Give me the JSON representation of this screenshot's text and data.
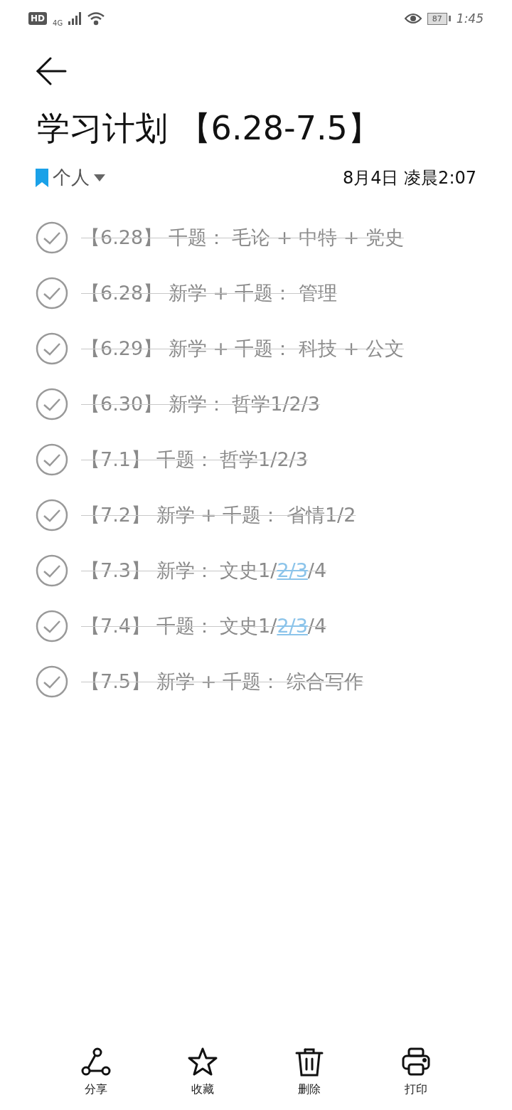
{
  "status_bar": {
    "hd": "HD",
    "network": "4G",
    "battery": "87",
    "time": "1:45"
  },
  "note": {
    "title": "学习计划 【6.28-7.5】",
    "category": "个人",
    "date": "8月4日 凌晨2:07"
  },
  "items": [
    {
      "done": true,
      "segments": [
        {
          "text": "【6.28】 千题： 毛论 + 中特 + 党史"
        }
      ]
    },
    {
      "done": true,
      "segments": [
        {
          "text": "【6.28】 新学 + 千题： 管理"
        }
      ]
    },
    {
      "done": true,
      "segments": [
        {
          "text": "【6.29】 新学 + 千题： 科技 + 公文"
        }
      ]
    },
    {
      "done": true,
      "segments": [
        {
          "text": "【6.30】 新学： 哲学1/2/3"
        }
      ]
    },
    {
      "done": true,
      "segments": [
        {
          "text": "【7.1】 千题： 哲学1/2/3"
        }
      ]
    },
    {
      "done": true,
      "segments": [
        {
          "text": "【7.2】 新学 + 千题： 省情1/2"
        }
      ]
    },
    {
      "done": true,
      "segments": [
        {
          "text": "【7.3】 新学： 文史1/"
        },
        {
          "text": "2/3",
          "kind": "link"
        },
        {
          "text": "/4"
        }
      ]
    },
    {
      "done": true,
      "segments": [
        {
          "text": "【7.4】 千题： 文史1/"
        },
        {
          "text": "2/3",
          "kind": "link"
        },
        {
          "text": "/4"
        }
      ]
    },
    {
      "done": true,
      "segments": [
        {
          "text": "【7.5】 新学 + 千题： 综合写作"
        }
      ]
    }
  ],
  "toolbar": [
    {
      "kind": "share",
      "label": "分享"
    },
    {
      "kind": "favorite",
      "label": "收藏"
    },
    {
      "kind": "delete",
      "label": "删除"
    },
    {
      "kind": "print",
      "label": "打印"
    }
  ]
}
